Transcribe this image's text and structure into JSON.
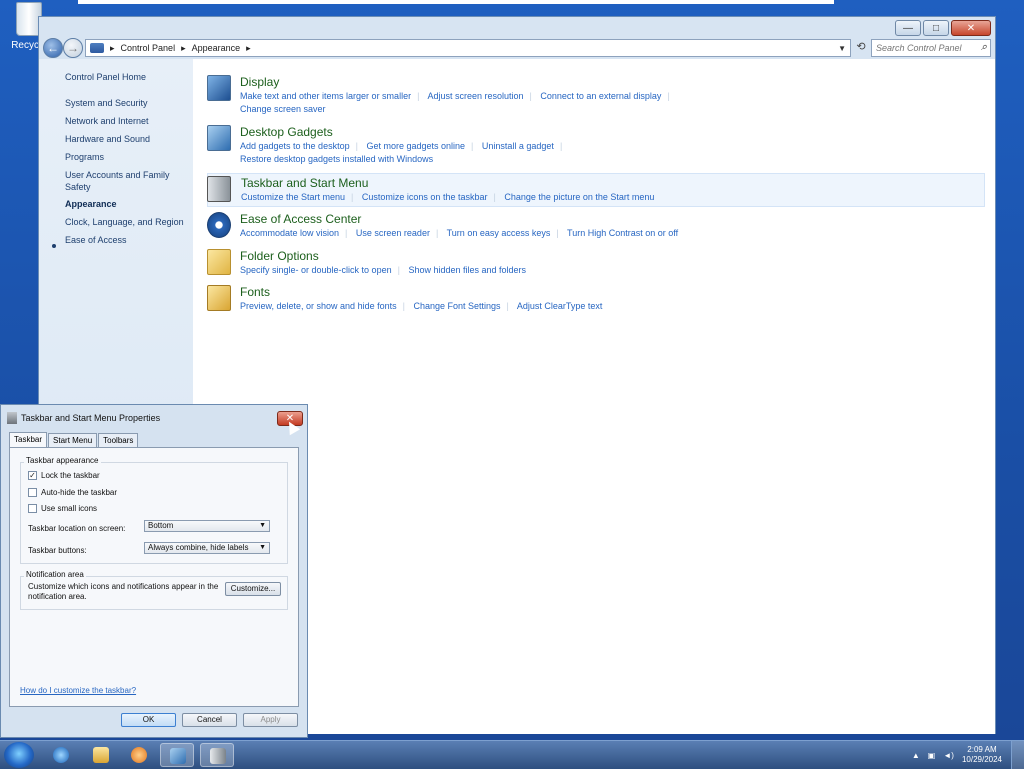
{
  "desktop": {
    "recycle_label": "Recycle"
  },
  "window": {
    "caption": {
      "minimize": "—",
      "maximize": "□",
      "close": "✕"
    },
    "address": {
      "segments": [
        "Control Panel",
        "Appearance"
      ],
      "sep": "▸"
    },
    "search_placeholder": "Search Control Panel"
  },
  "sidebar": {
    "items": [
      "Control Panel Home",
      "System and Security",
      "Network and Internet",
      "Hardware and Sound",
      "Programs",
      "User Accounts and Family Safety",
      "Appearance",
      "Clock, Language, and Region",
      "Ease of Access"
    ]
  },
  "categories": [
    {
      "title": "Display",
      "icon": "display-icon",
      "links": [
        "Make text and other items larger or smaller",
        "Adjust screen resolution",
        "Connect to an external display"
      ],
      "links2": [
        "Change screen saver"
      ]
    },
    {
      "title": "Desktop Gadgets",
      "icon": "gadgets-icon",
      "links": [
        "Add gadgets to the desktop",
        "Get more gadgets online",
        "Uninstall a gadget"
      ],
      "links2": [
        "Restore desktop gadgets installed with Windows"
      ]
    },
    {
      "title": "Taskbar and Start Menu",
      "icon": "taskbar-icon",
      "links": [
        "Customize the Start menu",
        "Customize icons on the taskbar",
        "Change the picture on the Start menu"
      ],
      "links2": []
    },
    {
      "title": "Ease of Access Center",
      "icon": "ease-of-access-icon",
      "links": [
        "Accommodate low vision",
        "Use screen reader",
        "Turn on easy access keys",
        "Turn High Contrast on or off"
      ],
      "links2": []
    },
    {
      "title": "Folder Options",
      "icon": "folder-icon",
      "links": [
        "Specify single- or double-click to open",
        "Show hidden files and folders"
      ],
      "links2": []
    },
    {
      "title": "Fonts",
      "icon": "fonts-icon",
      "links": [
        "Preview, delete, or show and hide fonts",
        "Change Font Settings",
        "Adjust ClearType text"
      ],
      "links2": []
    }
  ],
  "dialog": {
    "title": "Taskbar and Start Menu Properties",
    "close": "✕",
    "tabs": [
      "Taskbar",
      "Start Menu",
      "Toolbars"
    ],
    "appearance_group": "Taskbar appearance",
    "lock_label": "Lock the taskbar",
    "lock_checked": "✓",
    "autohide_label": "Auto-hide the taskbar",
    "small_icons_label": "Use small icons",
    "location_label": "Taskbar location on screen:",
    "location_value": "Bottom",
    "buttons_label": "Taskbar buttons:",
    "buttons_value": "Always combine, hide labels",
    "notif_group": "Notification area",
    "notif_text": "Customize which icons and notifications appear in the notification area.",
    "customize_button": "Customize...",
    "help_link": "How do I customize the taskbar?",
    "ok": "OK",
    "cancel": "Cancel",
    "apply": "Apply"
  },
  "taskbar": {
    "clock_time": "2:09 AM",
    "clock_date": "10/29/2024",
    "tray_arrow": "▲"
  },
  "colors": {
    "link": "#2766c2",
    "category_title": "#1c5f1c",
    "desktop": "#1f5fc0"
  }
}
